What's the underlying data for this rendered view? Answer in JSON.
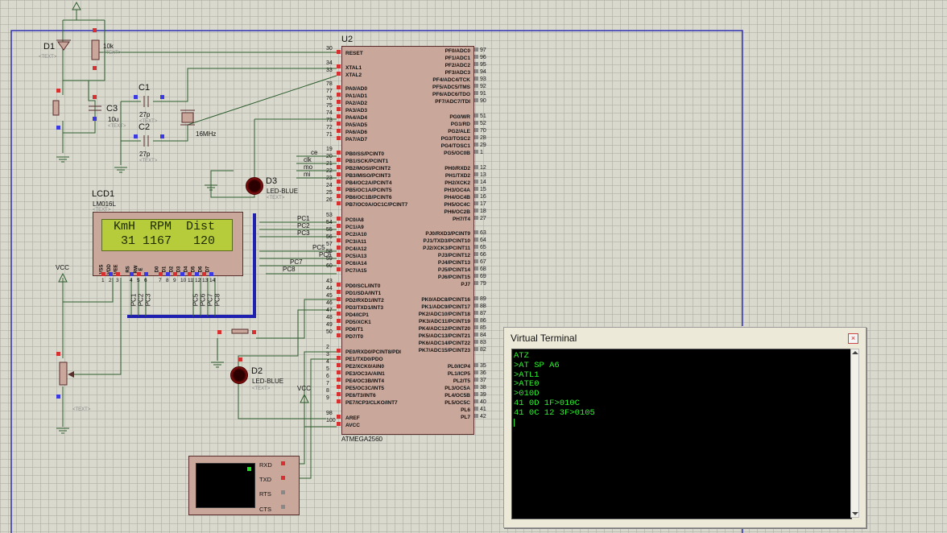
{
  "chip": {
    "ref": "U2",
    "part": "ATMEGA2560",
    "left_pins": [
      {
        "num": "30",
        "name": "RESET"
      },
      {
        "num": "34",
        "name": "XTAL1"
      },
      {
        "num": "33",
        "name": "XTAL2"
      },
      {
        "num": "78",
        "name": "PA0/AD0"
      },
      {
        "num": "77",
        "name": "PA1/AD1"
      },
      {
        "num": "76",
        "name": "PA2/AD2"
      },
      {
        "num": "75",
        "name": "PA3/AD3"
      },
      {
        "num": "74",
        "name": "PA4/AD4"
      },
      {
        "num": "73",
        "name": "PA5/AD5"
      },
      {
        "num": "72",
        "name": "PA6/AD6"
      },
      {
        "num": "71",
        "name": "PA7/AD7"
      },
      {
        "num": "19",
        "name": "PB0/SS/PCINT0"
      },
      {
        "num": "20",
        "name": "PB1/SCK/PCINT1"
      },
      {
        "num": "21",
        "name": "PB2/MOSI/PCINT2"
      },
      {
        "num": "22",
        "name": "PB3/MISO/PCINT3"
      },
      {
        "num": "23",
        "name": "PB4/OC2A/PCINT4"
      },
      {
        "num": "24",
        "name": "PB5/OC1A/PCINT5"
      },
      {
        "num": "25",
        "name": "PB6/OC1B/PCINT6"
      },
      {
        "num": "26",
        "name": "PB7/OC0A/OC1C/PCINT7"
      },
      {
        "num": "53",
        "name": "PC0/A8"
      },
      {
        "num": "54",
        "name": "PC1/A9"
      },
      {
        "num": "55",
        "name": "PC2/A10"
      },
      {
        "num": "56",
        "name": "PC3/A11"
      },
      {
        "num": "57",
        "name": "PC4/A12"
      },
      {
        "num": "58",
        "name": "PC5/A13"
      },
      {
        "num": "59",
        "name": "PC6/A14"
      },
      {
        "num": "60",
        "name": "PC7/A15"
      },
      {
        "num": "43",
        "name": "PD0/SCL/INT0"
      },
      {
        "num": "44",
        "name": "PD1/SDA/INT1"
      },
      {
        "num": "45",
        "name": "PD2/RXD1/INT2"
      },
      {
        "num": "46",
        "name": "PD3/TXD1/INT3"
      },
      {
        "num": "47",
        "name": "PD4/ICP1"
      },
      {
        "num": "48",
        "name": "PD5/XCK1"
      },
      {
        "num": "49",
        "name": "PD6/T1"
      },
      {
        "num": "50",
        "name": "PD7/T0"
      },
      {
        "num": "2",
        "name": "PE0/RXD0/PCINT8/PDI"
      },
      {
        "num": "3",
        "name": "PE1/TXD0/PDO"
      },
      {
        "num": "4",
        "name": "PE2/XCK0/AIN0"
      },
      {
        "num": "5",
        "name": "PE3/OC3A/AIN1"
      },
      {
        "num": "6",
        "name": "PE4/OC3B/INT4"
      },
      {
        "num": "7",
        "name": "PE5/OC3C/INT5"
      },
      {
        "num": "8",
        "name": "PE6/T3/INT6"
      },
      {
        "num": "9",
        "name": "PE7/ICP3/CLKO/INT7"
      },
      {
        "num": "98",
        "name": "AREF"
      },
      {
        "num": "100",
        "name": "AVCC"
      }
    ],
    "right_pins": [
      {
        "num": "97",
        "name": "PF0/ADC0"
      },
      {
        "num": "96",
        "name": "PF1/ADC1"
      },
      {
        "num": "95",
        "name": "PF2/ADC2"
      },
      {
        "num": "94",
        "name": "PF3/ADC3"
      },
      {
        "num": "93",
        "name": "PF4/ADC4/TCK"
      },
      {
        "num": "92",
        "name": "PF5/ADC5/TMS"
      },
      {
        "num": "91",
        "name": "PF6/ADC6/TDO"
      },
      {
        "num": "90",
        "name": "PF7/ADC7/TDI"
      },
      {
        "num": "51",
        "name": "PG0/WR"
      },
      {
        "num": "52",
        "name": "PG1/RD"
      },
      {
        "num": "70",
        "name": "PG2/ALE"
      },
      {
        "num": "28",
        "name": "PG3/TOSC2"
      },
      {
        "num": "29",
        "name": "PG4/TOSC1"
      },
      {
        "num": "1",
        "name": "PG5/OC0B"
      },
      {
        "num": "12",
        "name": "PH0/RXD2"
      },
      {
        "num": "13",
        "name": "PH1/TXD2"
      },
      {
        "num": "14",
        "name": "PH2/XCK2"
      },
      {
        "num": "15",
        "name": "PH3/OC4A"
      },
      {
        "num": "16",
        "name": "PH4/OC4B"
      },
      {
        "num": "17",
        "name": "PH5/OC4C"
      },
      {
        "num": "18",
        "name": "PH6/OC2B"
      },
      {
        "num": "27",
        "name": "PH7/T4"
      },
      {
        "num": "63",
        "name": "PJ0/RXD3/PCINT9"
      },
      {
        "num": "64",
        "name": "PJ1/TXD3/PCINT10"
      },
      {
        "num": "65",
        "name": "PJ2/XCK3/PCINT11"
      },
      {
        "num": "66",
        "name": "PJ3/PCINT12"
      },
      {
        "num": "67",
        "name": "PJ4/PCINT13"
      },
      {
        "num": "68",
        "name": "PJ5/PCINT14"
      },
      {
        "num": "69",
        "name": "PJ6/PCINT15"
      },
      {
        "num": "79",
        "name": "PJ7"
      },
      {
        "num": "89",
        "name": "PK0/ADC8/PCINT16"
      },
      {
        "num": "88",
        "name": "PK1/ADC9/PCINT17"
      },
      {
        "num": "87",
        "name": "PK2/ADC10/PCINT18"
      },
      {
        "num": "86",
        "name": "PK3/ADC11/PCINT19"
      },
      {
        "num": "85",
        "name": "PK4/ADC12/PCINT20"
      },
      {
        "num": "84",
        "name": "PK5/ADC13/PCINT21"
      },
      {
        "num": "83",
        "name": "PK6/ADC14/PCINT22"
      },
      {
        "num": "82",
        "name": "PK7/ADC15/PCINT23"
      },
      {
        "num": "35",
        "name": "PL0/ICP4"
      },
      {
        "num": "36",
        "name": "PL1/ICP5"
      },
      {
        "num": "37",
        "name": "PL2/T5"
      },
      {
        "num": "38",
        "name": "PL3/OC5A"
      },
      {
        "num": "39",
        "name": "PL4/OC5B"
      },
      {
        "num": "40",
        "name": "PL5/OC5C"
      },
      {
        "num": "41",
        "name": "PL6"
      },
      {
        "num": "42",
        "name": "PL7"
      }
    ]
  },
  "components": {
    "d1": {
      "ref": "D1",
      "text": "<TEXT>"
    },
    "r_10k": {
      "value": "10k",
      "text": "<TEXT>"
    },
    "c1": {
      "ref": "C1",
      "value": "27p",
      "text": "<TEXT>"
    },
    "c2": {
      "ref": "C2",
      "value": "27p",
      "text": "<TEXT>"
    },
    "c3": {
      "ref": "C3",
      "value": "10u",
      "text": "<TEXT>"
    },
    "crystal": {
      "value": "16MHz"
    },
    "d3": {
      "ref": "D3",
      "value": "LED-BLUE",
      "text": "<TEXT>"
    },
    "d2": {
      "ref": "D2",
      "value": "LED-BLUE",
      "text": "<TEXT>"
    },
    "lcd": {
      "ref": "LCD1",
      "part": "LM016L",
      "text": "<TEXT>",
      "line1": "KmH  RPM  Dist",
      "line2": " 31 1167   120",
      "pins": [
        "VSS",
        "VDD",
        "VEE",
        "RS",
        "RW",
        "E",
        "D0",
        "D1",
        "D2",
        "D3",
        "D4",
        "D5",
        "D6",
        "D7"
      ],
      "pin_nums": [
        "1",
        "2",
        "3",
        "4",
        "5",
        "6",
        "7",
        "8",
        "9",
        "10",
        "11",
        "12",
        "13",
        "14"
      ]
    },
    "pot": {
      "text": "<TEXT>"
    },
    "vcc_labels": [
      "VCC",
      "VCC"
    ],
    "vt_pins": [
      "RXD",
      "TXD",
      "RTS",
      "CTS"
    ]
  },
  "nets": {
    "spi": [
      "ce",
      "clk",
      "mo",
      "mi"
    ],
    "portc": [
      "PC1",
      "PC2",
      "PC3",
      "PC5",
      "PC6",
      "PC7",
      "PC8"
    ],
    "lcd_bus": [
      "PC1",
      "PC2",
      "PC3",
      "PC5",
      "PC6",
      "PC7",
      "PC8"
    ]
  },
  "virtual_terminal": {
    "title": "Virtual Terminal",
    "close": "×",
    "lines": [
      "ATZ",
      ">AT SP A6",
      ">ATL1",
      ">ATE0",
      ">010D",
      "41 0D 1F>010C",
      "41 0C 12 3F>0105"
    ]
  },
  "colors": {
    "wire": "#2f5e2f",
    "chip_fill": "#c9a79b",
    "chip_border": "#5a2d2d",
    "terminal_text": "#2ef02e",
    "lcd_bg": "#b6cc3a"
  }
}
